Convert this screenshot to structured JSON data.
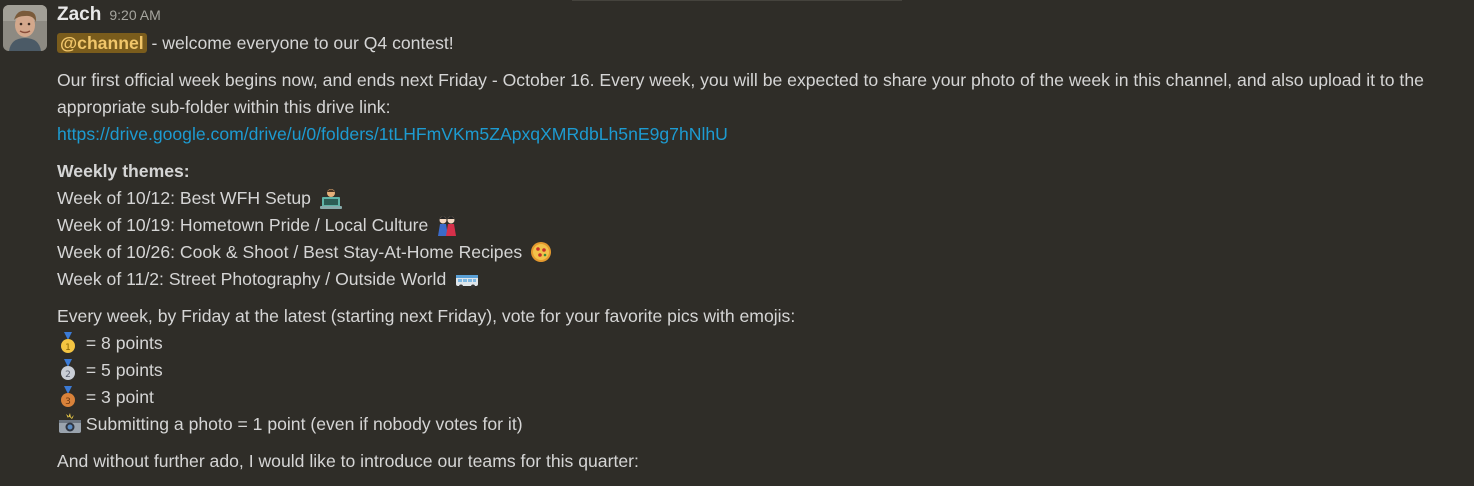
{
  "message": {
    "author": "Zach",
    "time": "9:20 AM",
    "mention": "@channel",
    "intro": " - welcome everyone to our Q4 contest!",
    "para1": "Our first official week begins now, and ends next Friday - October 16. Every week, you will be expected to share your photo of the week in this channel, and also upload it to the appropriate sub-folder within this drive link:",
    "drive_link": "https://drive.google.com/drive/u/0/folders/1tLHFmVKm5ZApxqXMRdbLh5nE9g7hNlhU",
    "themes_heading": "Weekly themes:",
    "themes": [
      {
        "text": "Week of 10/12: Best WFH Setup",
        "icon": "technologist-emoji"
      },
      {
        "text": "Week of 10/19: Hometown Pride / Local Culture",
        "icon": "dolls-emoji"
      },
      {
        "text": "Week of 10/26: Cook & Shoot / Best Stay-At-Home Recipes",
        "icon": "pizza-emoji"
      },
      {
        "text": "Week of 11/2: Street Photography / Outside World",
        "icon": "bus-emoji"
      }
    ],
    "voting_intro": "Every week, by Friday at the latest (starting next Friday), vote for your favorite pics with emojis:",
    "points": [
      {
        "icon": "first-place-medal-emoji",
        "text": " = 8 points"
      },
      {
        "icon": "second-place-medal-emoji",
        "text": " = 5 points"
      },
      {
        "icon": "third-place-medal-emoji",
        "text": " = 3 point"
      },
      {
        "icon": "camera-flash-emoji",
        "text": "  Submitting a photo = 1 point (even if nobody votes for it)"
      }
    ],
    "teams_intro": "And without further ado, I would like to introduce our teams for this quarter:"
  }
}
